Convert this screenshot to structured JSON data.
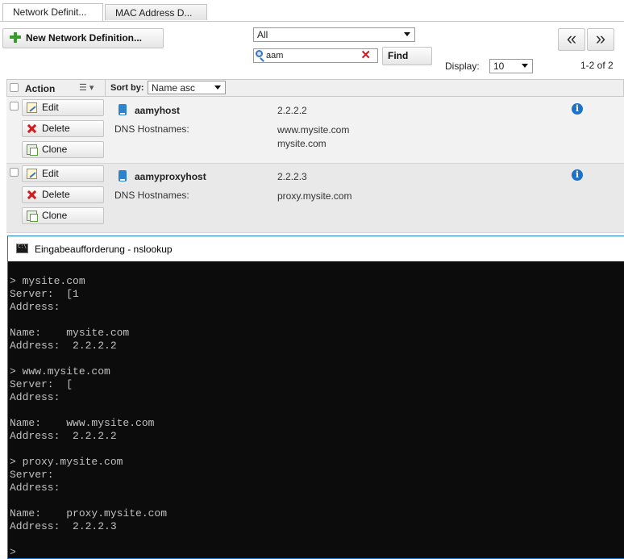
{
  "tabs": [
    {
      "label": "Network Definit..."
    },
    {
      "label": "MAC Address D..."
    }
  ],
  "toolbar": {
    "new_button": "New Network Definition...",
    "filter_value": "All",
    "search_value": "aam",
    "find_button": "Find",
    "prev_icon": "«",
    "next_icon": "»",
    "display_label": "Display:",
    "display_value": "10",
    "range": "1-2 of 2"
  },
  "table": {
    "action_header": "Action",
    "sort_label": "Sort by:",
    "sort_value": "Name asc",
    "actions": {
      "edit": "Edit",
      "delete": "Delete",
      "clone": "Clone"
    },
    "rows": [
      {
        "name": "aamyhost",
        "ip": "2.2.2.2",
        "dns_label": "DNS Hostnames:",
        "dns": [
          "www.mysite.com",
          "mysite.com"
        ]
      },
      {
        "name": "aamyproxyhost",
        "ip": "2.2.2.3",
        "dns_label": "DNS Hostnames:",
        "dns": [
          "proxy.mysite.com"
        ]
      }
    ]
  },
  "console": {
    "title": "Eingabeaufforderung - nslookup",
    "lines": [
      "> mysite.com",
      "Server:  [1",
      "Address:",
      "",
      "Name:    mysite.com",
      "Address:  2.2.2.2",
      "",
      "> www.mysite.com",
      "Server:  [",
      "Address:",
      "",
      "Name:    www.mysite.com",
      "Address:  2.2.2.2",
      "",
      "> proxy.mysite.com",
      "Server:",
      "Address:",
      "",
      "Name:    proxy.mysite.com",
      "Address:  2.2.2.3",
      "",
      ">"
    ]
  },
  "colors": {
    "accent_blue": "#1d72c7",
    "delete_red": "#d21b1b",
    "add_green": "#3a9b2f",
    "console_bg": "#0c0c0c"
  }
}
